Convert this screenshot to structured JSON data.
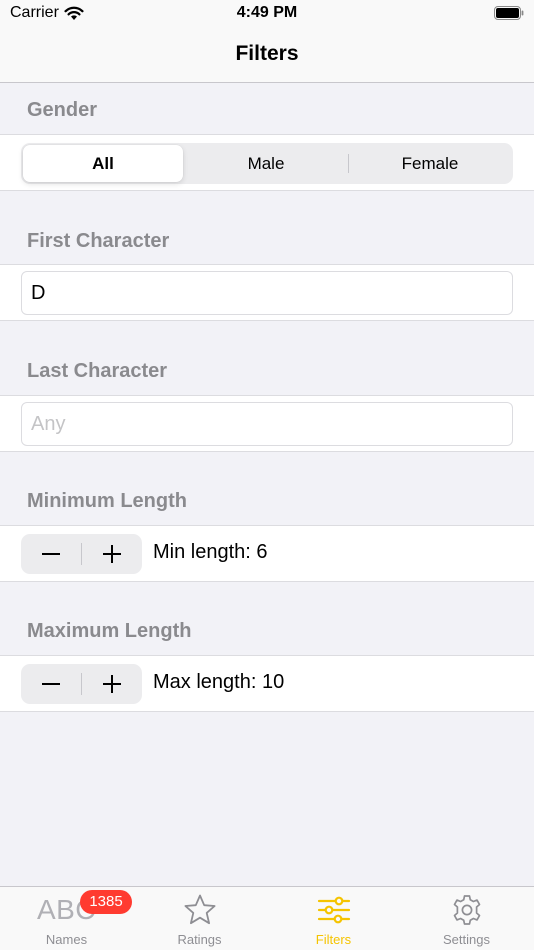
{
  "status_bar": {
    "carrier": "Carrier",
    "time": "4:49 PM"
  },
  "nav": {
    "title": "Filters"
  },
  "gender": {
    "header": "Gender",
    "options": [
      "All",
      "Male",
      "Female"
    ],
    "selected": "All"
  },
  "first_character": {
    "header": "First Character",
    "value": "D",
    "placeholder": "Any"
  },
  "last_character": {
    "header": "Last Character",
    "value": "",
    "placeholder": "Any"
  },
  "minimum_length": {
    "header": "Minimum Length",
    "label": "Min length: 6",
    "minus": "minus-icon",
    "plus": "plus-icon"
  },
  "maximum_length": {
    "header": "Maximum Length",
    "label": "Max length: 10",
    "minus": "minus-icon",
    "plus": "plus-icon"
  },
  "tab_bar": {
    "items": [
      {
        "label": "Names",
        "icon": "abc-icon",
        "icon_text": "ABC",
        "badge": "1385"
      },
      {
        "label": "Ratings",
        "icon": "star-icon"
      },
      {
        "label": "Filters",
        "icon": "sliders-icon",
        "active": true
      },
      {
        "label": "Settings",
        "icon": "gear-icon"
      }
    ]
  },
  "colors": {
    "accent": "#f5c400",
    "badge": "#ff3b30",
    "section_header": "#8a8a8e",
    "background": "#f2f2f7"
  }
}
